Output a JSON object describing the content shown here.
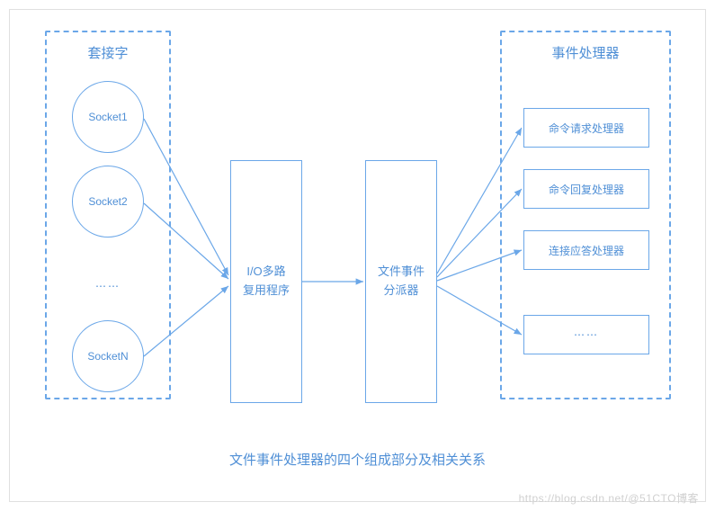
{
  "panels": {
    "left": {
      "title": "套接字"
    },
    "right": {
      "title": "事件处理器"
    }
  },
  "sockets": {
    "s1": "Socket1",
    "s2": "Socket2",
    "dots": "⋯⋯",
    "sN": "SocketN"
  },
  "io_multiplexer": {
    "line1": "I/O多路",
    "line2": "复用程序"
  },
  "dispatcher": {
    "line1": "文件事件",
    "line2": "分派器"
  },
  "handlers": {
    "h1": "命令请求处理器",
    "h2": "命令回复处理器",
    "h3": "连接应答处理器",
    "h4": "⋯⋯"
  },
  "caption": "文件事件处理器的四个组成部分及相关关系",
  "watermark": "https://blog.csdn.net/@51CTO博客",
  "colors": {
    "accent": "#6ba7e8",
    "text": "#4f8fd6"
  }
}
